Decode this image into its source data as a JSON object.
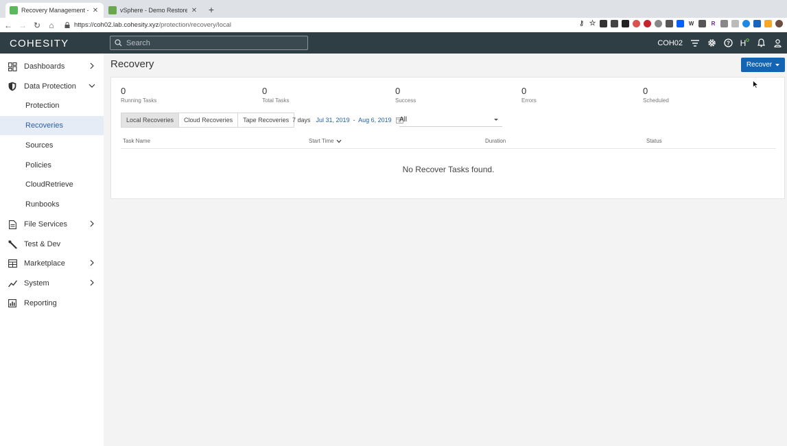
{
  "browser": {
    "tabs": [
      {
        "title": "Recovery Management - Local",
        "active": true,
        "favicon": "cohesity-favicon"
      },
      {
        "title": "vSphere - Demo Restores - Su",
        "active": false,
        "favicon": "vsphere-favicon"
      }
    ],
    "url_host": "https://coh02.lab.cohesity.xyz",
    "url_path": "/protection/recovery/local"
  },
  "header": {
    "logo": "COHESITY",
    "search_placeholder": "Search",
    "cluster": "COH02"
  },
  "sidebar": {
    "items": [
      {
        "label": "Dashboards",
        "icon": "dashboard-icon",
        "chevron": "right"
      },
      {
        "label": "Data Protection",
        "icon": "shield-icon",
        "chevron": "down"
      },
      {
        "label": "File Services",
        "icon": "file-icon",
        "chevron": "right"
      },
      {
        "label": "Test & Dev",
        "icon": "wrench-icon",
        "chevron": ""
      },
      {
        "label": "Marketplace",
        "icon": "marketplace-icon",
        "chevron": "right"
      },
      {
        "label": "System",
        "icon": "system-icon",
        "chevron": "right"
      },
      {
        "label": "Reporting",
        "icon": "reporting-icon",
        "chevron": ""
      }
    ],
    "sub_items": [
      "Protection",
      "Recoveries",
      "Sources",
      "Policies",
      "CloudRetrieve",
      "Runbooks"
    ],
    "active_sub": "Recoveries"
  },
  "main": {
    "title": "Recovery",
    "recover_button": "Recover",
    "stats": [
      {
        "value": "0",
        "label": "Running Tasks"
      },
      {
        "value": "0",
        "label": "Total Tasks"
      },
      {
        "value": "0",
        "label": "Success"
      },
      {
        "value": "0",
        "label": "Errors"
      },
      {
        "value": "0",
        "label": "Scheduled"
      }
    ],
    "tabs": [
      "Local Recoveries",
      "Cloud Recoveries",
      "Tape Recoveries"
    ],
    "active_tab": "Local Recoveries",
    "range_label": "7 days",
    "range_dates": "Jul 31, 2019  -  Aug 6, 2019",
    "filter_value": "All",
    "columns": [
      "Task Name",
      "Start Time",
      "Duration",
      "Status"
    ],
    "empty_message": "No Recover Tasks found."
  },
  "colors": {
    "header_bg": "#2f3d44",
    "accent": "#1464b4",
    "active_nav_bg": "#e6ecf5"
  }
}
